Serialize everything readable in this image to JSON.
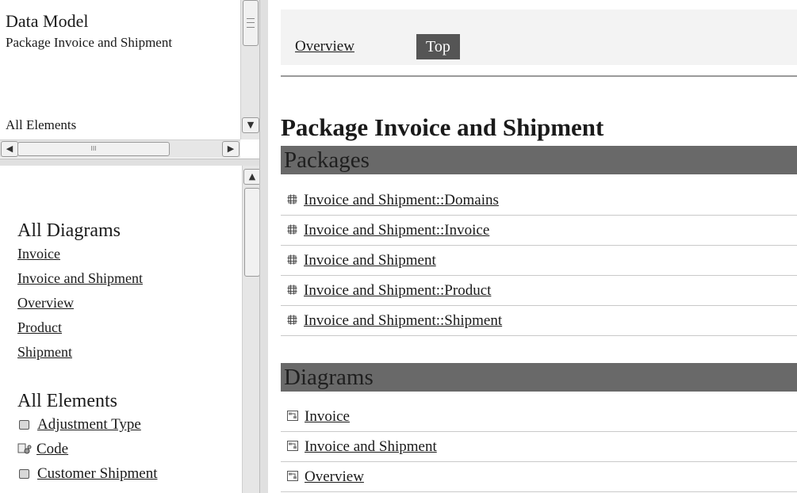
{
  "left_top": {
    "title": "Data Model",
    "package": "Package Invoice and Shipment",
    "all_elements": "All Elements",
    "hscroll_thumb_grip": "III"
  },
  "left_bottom": {
    "diagrams_heading": "All Diagrams",
    "diagrams": [
      "Invoice",
      "Invoice and Shipment",
      "Overview",
      "Product",
      "Shipment"
    ],
    "elements_heading": "All Elements",
    "elements": [
      {
        "label": "Adjustment Type",
        "icon": "class-icon"
      },
      {
        "label": "Code",
        "icon": "datatype-icon"
      },
      {
        "label": "Customer Shipment",
        "icon": "class-icon"
      }
    ]
  },
  "nav": {
    "overview": "Overview",
    "top": "Top"
  },
  "main": {
    "title": "Package Invoice and Shipment",
    "packages_heading": "Packages",
    "packages": [
      "Invoice and Shipment::Domains",
      "Invoice and Shipment::Invoice",
      "Invoice and Shipment",
      "Invoice and Shipment::Product",
      "Invoice and Shipment::Shipment"
    ],
    "diagrams_heading": "Diagrams",
    "diagrams": [
      "Invoice",
      "Invoice and Shipment",
      "Overview"
    ]
  },
  "scrollbars": {
    "up_arrow": "▲",
    "down_arrow": "▼",
    "left_arrow": "◀",
    "right_arrow": "▶"
  }
}
